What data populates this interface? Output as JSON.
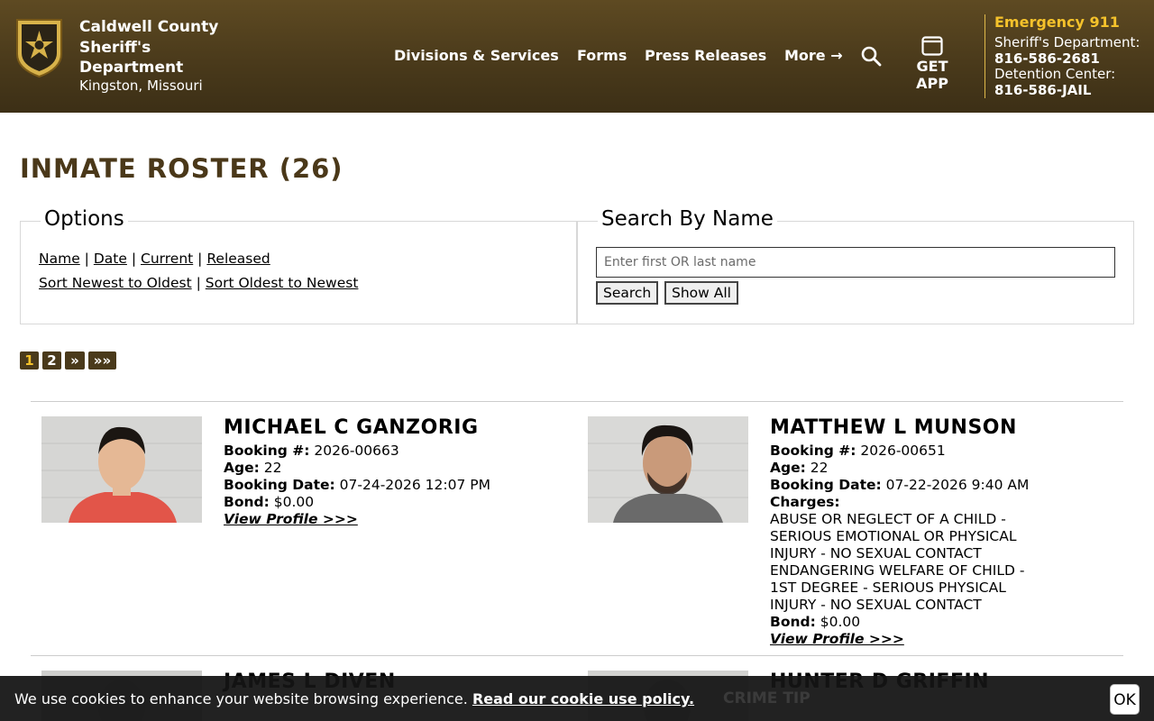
{
  "header": {
    "brand_name": "Caldwell County Sheriff's Department",
    "brand_location": "Kingston, Missouri",
    "nav": {
      "divisions": "Divisions & Services",
      "forms": "Forms",
      "press": "Press Releases",
      "more": "More →"
    },
    "search_icon": "search-icon",
    "app_label": "GET APP",
    "emergency": {
      "title": "Emergency 911",
      "sheriff_label": "Sheriff's Department:",
      "sheriff_phone": "816-586-2681",
      "detention_label": "Detention Center:",
      "detention_phone": "816-586-JAIL"
    },
    "colors": {
      "header_bg": "#4a3a1b",
      "accent": "#f5c22b"
    }
  },
  "page": {
    "title": "INMATE ROSTER (26)"
  },
  "options": {
    "legend": "Options",
    "links_row1": [
      "Name",
      "Date",
      "Current",
      "Released"
    ],
    "links_row2": [
      "Sort Newest to Oldest",
      "Sort Oldest to Newest"
    ],
    "separator": "|"
  },
  "search": {
    "legend": "Search By Name",
    "placeholder": "Enter first OR last name",
    "value": "",
    "search_label": "Search",
    "show_all_label": "Show All"
  },
  "pagination": {
    "pages": [
      "1",
      "2",
      "»",
      "»»"
    ],
    "current": "1"
  },
  "roster": [
    {
      "name": "MICHAEL C GANZORIG",
      "booking_label": "Booking #:",
      "booking": "2026-00663",
      "age_label": "Age:",
      "age": "22",
      "date_label": "Booking Date:",
      "date": "07-24-2026 12:07 PM",
      "bond_label": "Bond:",
      "bond": "$0.00",
      "view": "View Profile >>>"
    },
    {
      "name": "MATTHEW L MUNSON",
      "booking_label": "Booking #:",
      "booking": "2026-00651",
      "age_label": "Age:",
      "age": "22",
      "date_label": "Booking Date:",
      "date": "07-22-2026 9:40 AM",
      "charges_label": "Charges:",
      "charges": [
        "ABUSE OR NEGLECT OF A CHILD - SERIOUS EMOTIONAL OR PHYSICAL INJURY - NO SEXUAL CONTACT",
        "ENDANGERING WELFARE OF CHILD - 1ST DEGREE - SERIOUS PHYSICAL INJURY - NO SEXUAL CONTACT"
      ],
      "bond_label": "Bond:",
      "bond": "$0.00",
      "view": "View Profile >>>"
    },
    {
      "name": "JAMES L DIVEN"
    },
    {
      "name": "HUNTER D GRIFFIN"
    }
  ],
  "cookie": {
    "text": "We use cookies to enhance your website browsing experience.",
    "link": "Read our cookie use policy.",
    "ok": "OK",
    "behind_label": "CRIME TIP"
  }
}
